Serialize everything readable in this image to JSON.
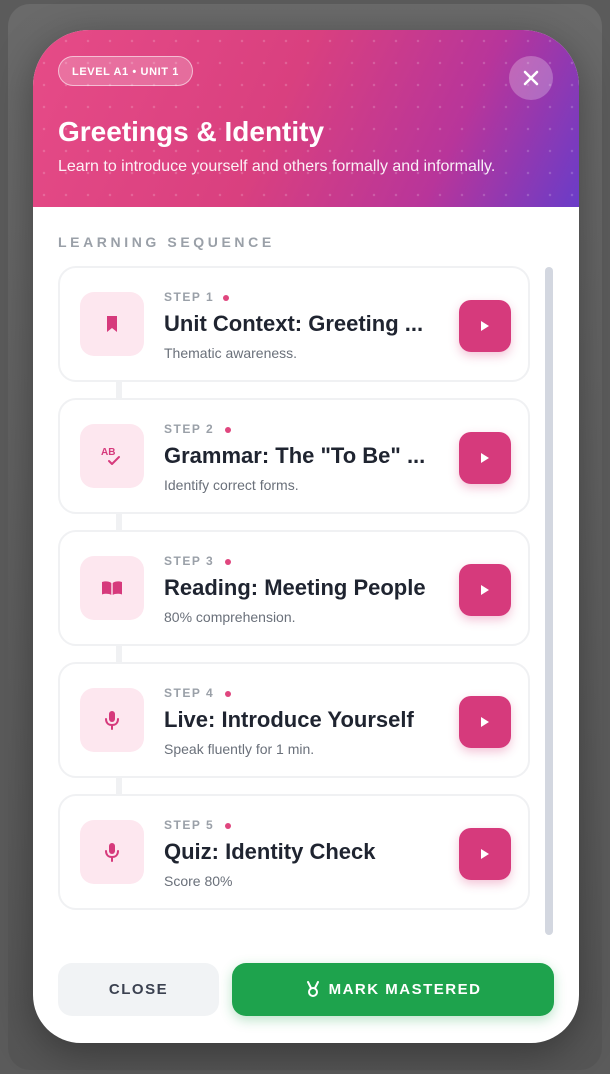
{
  "header": {
    "badge": "LEVEL A1 • UNIT 1",
    "title": "Greetings & Identity",
    "subtitle": "Learn to introduce yourself and others formally and informally.",
    "gradient_colors": [
      "#e64b87",
      "#6a3cc8"
    ]
  },
  "section_label": "LEARNING SEQUENCE",
  "steps": [
    {
      "step": "STEP 1",
      "title": "Unit Context: Greeting ...",
      "description": "Thematic awareness.",
      "icon": "bookmark-icon"
    },
    {
      "step": "STEP 2",
      "title": "Grammar: The \"To Be\" ...",
      "description": "Identify correct forms.",
      "icon": "spellcheck-icon"
    },
    {
      "step": "STEP 3",
      "title": "Reading: Meeting People",
      "description": "80% comprehension.",
      "icon": "book-icon"
    },
    {
      "step": "STEP 4",
      "title": "Live: Introduce Yourself",
      "description": "Speak fluently for 1 min.",
      "icon": "microphone-icon"
    },
    {
      "step": "STEP 5",
      "title": "Quiz: Identity Check",
      "description": "Score 80%",
      "icon": "microphone-icon"
    }
  ],
  "footer": {
    "close_label": "CLOSE",
    "master_label": "MARK MASTERED"
  },
  "colors": {
    "accent": "#d63a7c",
    "success": "#1ea34d",
    "icon_bg": "#fde7ef"
  }
}
